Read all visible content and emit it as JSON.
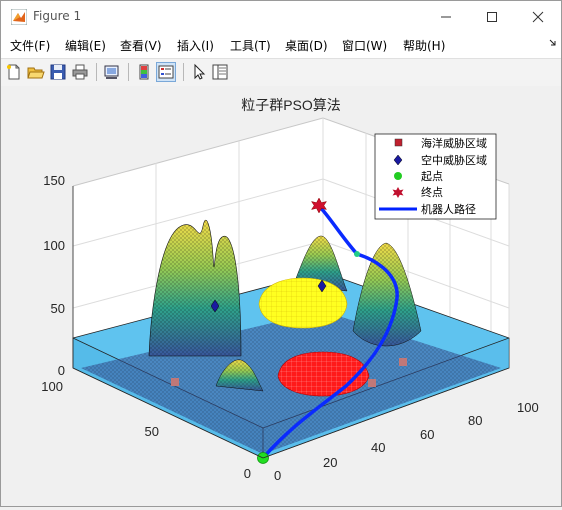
{
  "window": {
    "title": "Figure 1"
  },
  "menu": [
    "文件(F)",
    "编辑(E)",
    "查看(V)",
    "插入(I)",
    "工具(T)",
    "桌面(D)",
    "窗口(W)",
    "帮助(H)"
  ],
  "toolbar": {
    "icons": [
      "new-figure-icon",
      "open-file-icon",
      "save-icon",
      "print-icon",
      "link-plot-icon",
      "insert-colorbar-icon",
      "insert-legend-icon",
      "pointer-icon",
      "property-inspector-icon"
    ]
  },
  "chart_data": {
    "type": "surface3d",
    "title": "粒子群PSO算法",
    "z_ticks": [
      "0",
      "50",
      "100",
      "150"
    ],
    "x_ticks": [
      "0",
      "20",
      "40",
      "60",
      "80",
      "100"
    ],
    "y_ticks": [
      "0",
      "50",
      "100"
    ],
    "zlim": [
      0,
      150
    ],
    "xlim": [
      0,
      100
    ],
    "ylim": [
      0,
      100
    ],
    "legend": {
      "position": "top-right",
      "entries": [
        {
          "label": "海洋威胁区域",
          "marker": "square",
          "color": "#c0202e"
        },
        {
          "label": "空中威胁区域",
          "marker": "diamond",
          "color": "#1a1aa0"
        },
        {
          "label": "起点",
          "marker": "circle",
          "color": "#22cc22"
        },
        {
          "label": "终点",
          "marker": "hexagram",
          "color": "#c0102e"
        },
        {
          "label": "机器人路径",
          "marker": "line",
          "color": "#0022ff"
        }
      ]
    },
    "colors": {
      "water": "#5fc3ef",
      "surface_high": "#f7e04a",
      "surface_low": "#3a5aa0",
      "dome_yellow": "#ffff20",
      "dome_red": "#ff1010",
      "path": "#0a2aff"
    }
  }
}
